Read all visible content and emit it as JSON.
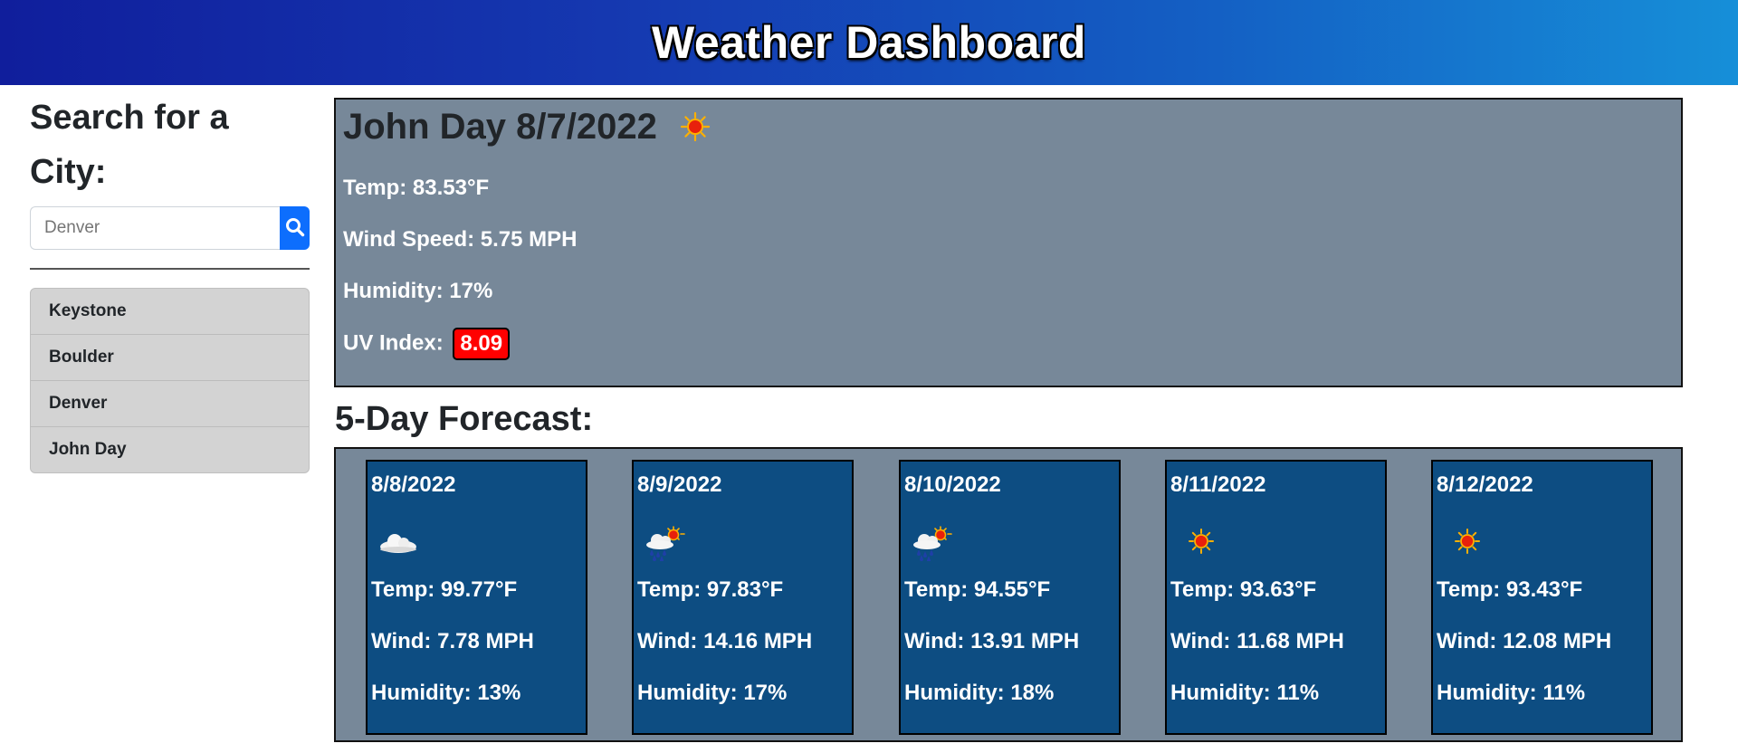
{
  "header": {
    "title": "Weather Dashboard"
  },
  "sidebar": {
    "search_title": "Search for a City:",
    "search_value": "Denver",
    "search_button_icon": "search-icon",
    "history": [
      "Keystone",
      "Boulder",
      "Denver",
      "John Day"
    ]
  },
  "current": {
    "title": "John Day 8/7/2022",
    "icon": "sun-icon",
    "temp": "Temp: 83.53°F",
    "wind": "Wind Speed: 5.75 MPH",
    "humidity": "Humidity: 17%",
    "uv_label": "UV Index:",
    "uv_value": "8.09",
    "uv_color": "#ff0000"
  },
  "forecast": {
    "title": "5-Day Forecast:",
    "days": [
      {
        "date": "8/8/2022",
        "icon": "cloud-icon",
        "temp": "Temp: 99.77°F",
        "wind": "Wind: 7.78 MPH",
        "humidity": "Humidity: 13%"
      },
      {
        "date": "8/9/2022",
        "icon": "rain-sun-icon",
        "temp": "Temp: 97.83°F",
        "wind": "Wind: 14.16 MPH",
        "humidity": "Humidity: 17%"
      },
      {
        "date": "8/10/2022",
        "icon": "rain-sun-icon",
        "temp": "Temp: 94.55°F",
        "wind": "Wind: 13.91 MPH",
        "humidity": "Humidity: 18%"
      },
      {
        "date": "8/11/2022",
        "icon": "sun-icon",
        "temp": "Temp: 93.63°F",
        "wind": "Wind: 11.68 MPH",
        "humidity": "Humidity: 11%"
      },
      {
        "date": "8/12/2022",
        "icon": "sun-icon",
        "temp": "Temp: 93.43°F",
        "wind": "Wind: 12.08 MPH",
        "humidity": "Humidity: 11%"
      }
    ]
  },
  "colors": {
    "header_start": "#101e9c",
    "header_end": "#168fd8",
    "panel_bg": "#778899",
    "card_bg": "#0d4d82",
    "search_button": "#0d6efd",
    "history_bg": "#d3d3d3"
  }
}
